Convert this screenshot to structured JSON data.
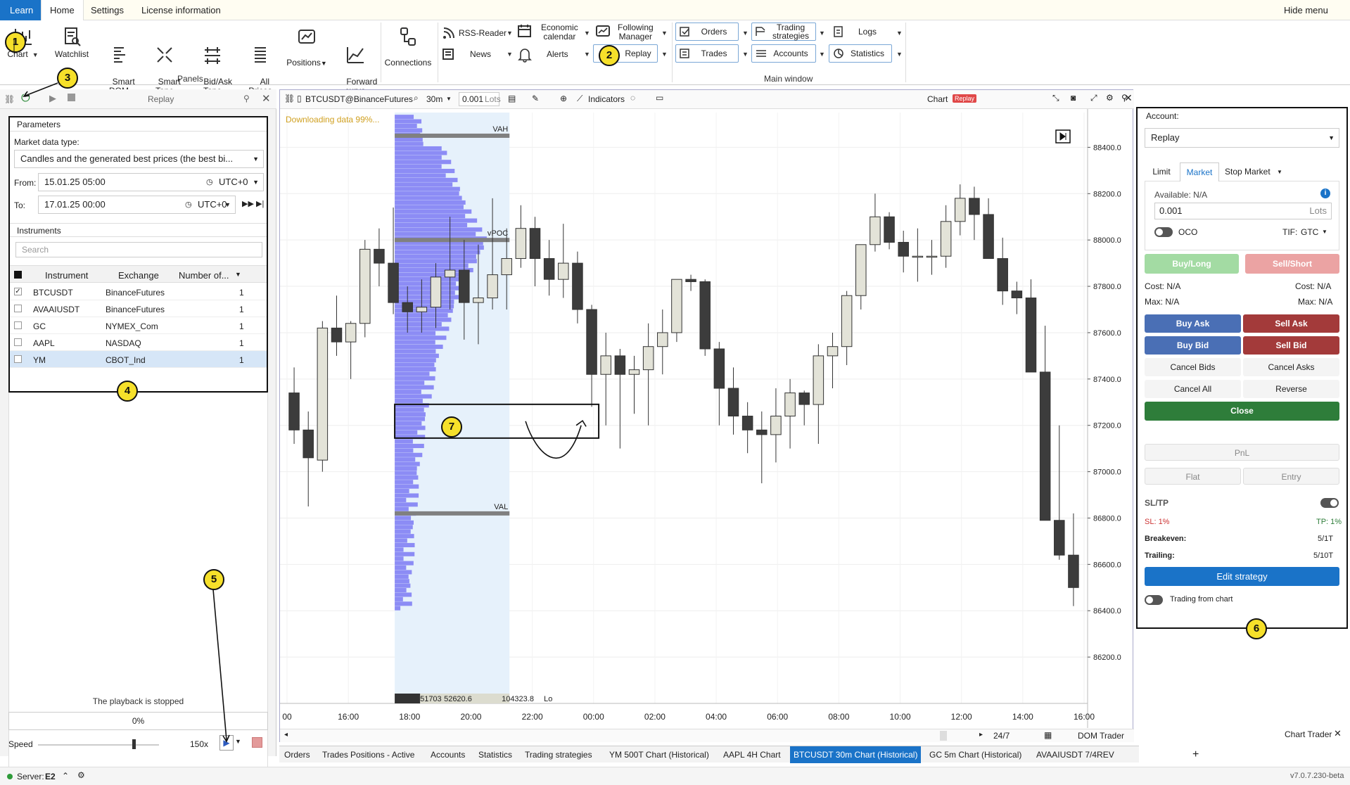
{
  "menu": {
    "learn": "Learn",
    "home": "Home",
    "settings": "Settings",
    "license": "License information",
    "hide": "Hide menu"
  },
  "ribbon": {
    "chart": "Chart",
    "watchlist": "Watchlist",
    "smart_dom": "Smart\nDOM",
    "smart_tape": "Smart\nTape",
    "bidask_tape": "Bid/Ask\nTape",
    "all_prices": "All\nPrices",
    "positions": "Positions",
    "forward_curve": "Forward\ncurve",
    "connections": "Connections",
    "rss": "RSS-Reader",
    "econ": "Economic\ncalendar",
    "following": "Following\nManager",
    "news": "News",
    "alerts": "Alerts",
    "replay": "Replay",
    "orders": "Orders",
    "trading_strategies": "Trading\nstrategies",
    "logs": "Logs",
    "trades": "Trades",
    "accounts": "Accounts",
    "statistics": "Statistics",
    "group_panels": "Panels",
    "group_main": "Main window"
  },
  "callouts": [
    "1",
    "2",
    "3",
    "4",
    "5",
    "6",
    "7"
  ],
  "replay_panel": {
    "title": "Replay",
    "parameters": "Parameters",
    "market_data_type_label": "Market data type:",
    "market_data_type": "Candles and the generated best prices (the best bi...",
    "from_label": "From:",
    "from": "15.01.25 05:00",
    "from_tz": "UTC+0",
    "to_label": "To:",
    "to": "17.01.25 00:00",
    "to_tz": "UTC+0",
    "instruments": "Instruments",
    "search_placeholder": "Search",
    "columns": [
      "Instrument",
      "Exchange",
      "Number of..."
    ],
    "rows": [
      {
        "name": "BTCUSDT",
        "exchange": "BinanceFutures",
        "num": "1",
        "checked": true
      },
      {
        "name": "AVAAIUSDT",
        "exchange": "BinanceFutures",
        "num": "1",
        "checked": false
      },
      {
        "name": "GC",
        "exchange": "NYMEX_Com",
        "num": "1",
        "checked": false
      },
      {
        "name": "AAPL",
        "exchange": "NASDAQ",
        "num": "1",
        "checked": false
      },
      {
        "name": "YM",
        "exchange": "CBOT_Ind",
        "num": "1",
        "checked": false
      }
    ],
    "status": "The playback is stopped",
    "progress": "0%",
    "progress_value": 0,
    "speed_label": "Speed",
    "speed_value": "150x"
  },
  "chart": {
    "symbol": "BTCUSDT@BinanceFutures",
    "timeframe": "30m",
    "lots": "0.001",
    "lots_unit": "Lots",
    "indicators": "Indicators",
    "title": "Chart",
    "badge": "Replay",
    "downloading": "Downloading data 99%...",
    "price_labels": [
      "88400.0",
      "88200.0",
      "88000.0",
      "87800.0",
      "87600.0",
      "87400.0",
      "87200.0",
      "87000.0",
      "86800.0",
      "86600.0",
      "86400.0",
      "86200.0"
    ],
    "time_labels": [
      "00",
      "16:00",
      "18:00",
      "20:00",
      "22:00",
      "00:00",
      "02:00",
      "04:00",
      "06:00",
      "08:00",
      "10:00",
      "12:00",
      "14:00",
      "16:00"
    ],
    "vah": "VAH",
    "vpoc": "vPOC",
    "val": "VAL",
    "profile_stats": [
      "51703",
      "52620.6",
      "104323.8",
      "Lo"
    ],
    "session": "24/7",
    "dom_trader": "DOM Trader",
    "chart_trader": "Chart Trader"
  },
  "trader": {
    "account_label": "Account:",
    "account": "Replay",
    "tabs": [
      "Limit",
      "Market",
      "Stop Market"
    ],
    "available": "Available: N/A",
    "qty": "0.001",
    "qty_unit": "Lots",
    "oco": "OCO",
    "tif_label": "TIF:",
    "tif": "GTC",
    "buy_long": "Buy/Long",
    "sell_short": "Sell/Short",
    "cost_l": "Cost: N/A",
    "cost_r": "Cost: N/A",
    "max_l": "Max: N/A",
    "max_r": "Max: N/A",
    "buy_ask": "Buy Ask",
    "sell_ask": "Sell Ask",
    "buy_bid": "Buy Bid",
    "sell_bid": "Sell Bid",
    "cancel_bids": "Cancel Bids",
    "cancel_asks": "Cancel Asks",
    "cancel_all": "Cancel All",
    "reverse": "Reverse",
    "close": "Close",
    "pnl": "PnL",
    "flat": "Flat",
    "entry": "Entry",
    "sltp": "SL/TP",
    "sl": "SL: 1%",
    "tp": "TP: 1%",
    "breakeven": "Breakeven:",
    "breakeven_val": "5/1T",
    "trailing": "Trailing:",
    "trailing_val": "5/10T",
    "edit_strategy": "Edit strategy",
    "trading_from_chart": "Trading from chart"
  },
  "bottom_tabs": [
    "Orders",
    "Trades",
    "Positions - Active",
    "Accounts",
    "Statistics",
    "Trading strategies",
    "YM 500T Chart (Historical)",
    "AAPL 4H Chart",
    "BTCUSDT 30m Chart (Historical)",
    "GC 5m Chart (Historical)",
    "AVAAIUSDT 7/4REV Chart (Historical)"
  ],
  "status": {
    "server_label": "Server:",
    "server": "E2",
    "version": "v7.0.7.230-beta"
  },
  "colors": {
    "accent": "#1a73c8",
    "buy": "#4a6fb5",
    "sell": "#a33a3a",
    "close": "#2e7d3a",
    "profile": "#8c8cf5",
    "highlight": "#e6f1fb",
    "bull": "#e3e3d8",
    "bear": "#3c3c3c"
  },
  "chart_data": {
    "type": "candlestick",
    "x": [
      "15:00",
      "15:30",
      "16:00",
      "16:30",
      "17:00",
      "17:30",
      "18:00",
      "18:30",
      "19:00",
      "19:30",
      "20:00",
      "20:30",
      "21:00",
      "21:30",
      "22:00",
      "22:30",
      "23:00",
      "23:30",
      "00:00",
      "00:30",
      "01:00",
      "01:30",
      "02:00",
      "02:30",
      "03:00",
      "03:30",
      "04:00",
      "04:30",
      "05:00",
      "05:30",
      "06:00",
      "06:30",
      "07:00",
      "07:30",
      "08:00",
      "08:30",
      "09:00",
      "09:30",
      "10:00",
      "10:30",
      "11:00",
      "11:30",
      "12:00",
      "12:30",
      "13:00",
      "13:30",
      "14:00",
      "14:30",
      "15:00",
      "15:30",
      "16:00",
      "16:30"
    ],
    "ohlc": [
      [
        87340,
        87450,
        87120,
        87180
      ],
      [
        87180,
        87260,
        86850,
        87060
      ],
      [
        87050,
        87650,
        87000,
        87620
      ],
      [
        87620,
        87760,
        87500,
        87560
      ],
      [
        87560,
        87650,
        87400,
        87640
      ],
      [
        87640,
        88000,
        87580,
        87960
      ],
      [
        87960,
        88050,
        87800,
        87900
      ],
      [
        87900,
        88140,
        87680,
        87730
      ],
      [
        87730,
        87800,
        87600,
        87690
      ],
      [
        87690,
        87830,
        87600,
        87710
      ],
      [
        87710,
        87900,
        87620,
        87840
      ],
      [
        87840,
        88100,
        87700,
        87870
      ],
      [
        87870,
        88000,
        87570,
        87730
      ],
      [
        87730,
        87980,
        87550,
        87750
      ],
      [
        87750,
        88180,
        87700,
        87850
      ],
      [
        87850,
        88050,
        87700,
        87920
      ],
      [
        87920,
        88150,
        87880,
        88050
      ],
      [
        88050,
        88100,
        87800,
        87920
      ],
      [
        87920,
        88000,
        87760,
        87830
      ],
      [
        87830,
        88070,
        87750,
        87900
      ],
      [
        87900,
        87950,
        87640,
        87700
      ],
      [
        87700,
        87720,
        87280,
        87420
      ],
      [
        87420,
        87600,
        87200,
        87500
      ],
      [
        87500,
        87530,
        87100,
        87420
      ],
      [
        87420,
        87500,
        87250,
        87440
      ],
      [
        87440,
        87640,
        87200,
        87540
      ],
      [
        87540,
        87700,
        87420,
        87600
      ],
      [
        87600,
        87830,
        87560,
        87830
      ],
      [
        87830,
        87850,
        87780,
        87820
      ],
      [
        87820,
        87830,
        87500,
        87530
      ],
      [
        87530,
        87560,
        87200,
        87360
      ],
      [
        87360,
        87450,
        87160,
        87240
      ],
      [
        87240,
        87300,
        87080,
        87180
      ],
      [
        87180,
        87260,
        86950,
        87160
      ],
      [
        87160,
        87360,
        87040,
        87240
      ],
      [
        87240,
        87400,
        87100,
        87340
      ],
      [
        87340,
        87350,
        87200,
        87290
      ],
      [
        87290,
        87550,
        87120,
        87500
      ],
      [
        87500,
        87600,
        87360,
        87540
      ],
      [
        87540,
        87780,
        87460,
        87760
      ],
      [
        87760,
        87950,
        87700,
        87980
      ],
      [
        87980,
        88200,
        87950,
        88100
      ],
      [
        88100,
        88120,
        87960,
        87990
      ],
      [
        87990,
        88040,
        87860,
        87930
      ],
      [
        87930,
        88050,
        87820,
        87930
      ],
      [
        87930,
        88000,
        87850,
        87930
      ],
      [
        87930,
        88150,
        87880,
        88080
      ],
      [
        88080,
        88240,
        88020,
        88180
      ],
      [
        88180,
        88230,
        88000,
        88110
      ],
      [
        88110,
        88180,
        87920,
        87920
      ],
      [
        87920,
        88010,
        87720,
        87780
      ],
      [
        87780,
        87820,
        87680,
        87750
      ],
      [
        87750,
        87830,
        87600,
        87430
      ],
      [
        87430,
        87630,
        87300,
        86790
      ],
      [
        86790,
        87200,
        86620,
        86640
      ],
      [
        86640,
        86820,
        86420,
        86500
      ]
    ],
    "ylim": [
      86000,
      88550
    ],
    "value_area": {
      "vah": 88450,
      "vpoc": 88000,
      "val": 86820
    }
  }
}
